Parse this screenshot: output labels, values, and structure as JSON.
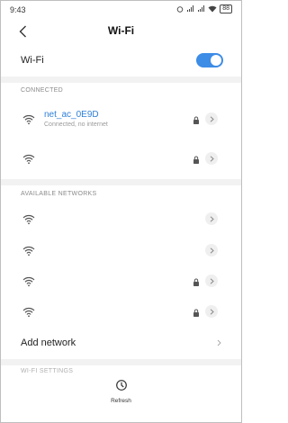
{
  "status": {
    "time": "9:43",
    "battery": "88"
  },
  "header": {
    "title": "Wi-Fi"
  },
  "wifi_toggle": {
    "label": "Wi-Fi",
    "on": true
  },
  "sections": {
    "connected": "CONNECTED",
    "available": "AVAILABLE NETWORKS",
    "settings": "WI-FI SETTINGS"
  },
  "connected_networks": [
    {
      "name": "net_ac_0E9D",
      "status": "Connected, no internet",
      "secured": true
    },
    {
      "name": "",
      "status": "",
      "secured": true
    }
  ],
  "available_networks": [
    {
      "secured": false
    },
    {
      "secured": false
    },
    {
      "secured": true
    },
    {
      "secured": true
    }
  ],
  "add_network": {
    "label": "Add network"
  },
  "refresh": {
    "label": "Refresh"
  },
  "colors": {
    "accent": "#3d8ce6",
    "divider": "#f2f2f2"
  },
  "icons": [
    "back-arrow-icon",
    "wifi-icon",
    "lock-icon",
    "chevron-right-icon",
    "refresh-icon"
  ]
}
